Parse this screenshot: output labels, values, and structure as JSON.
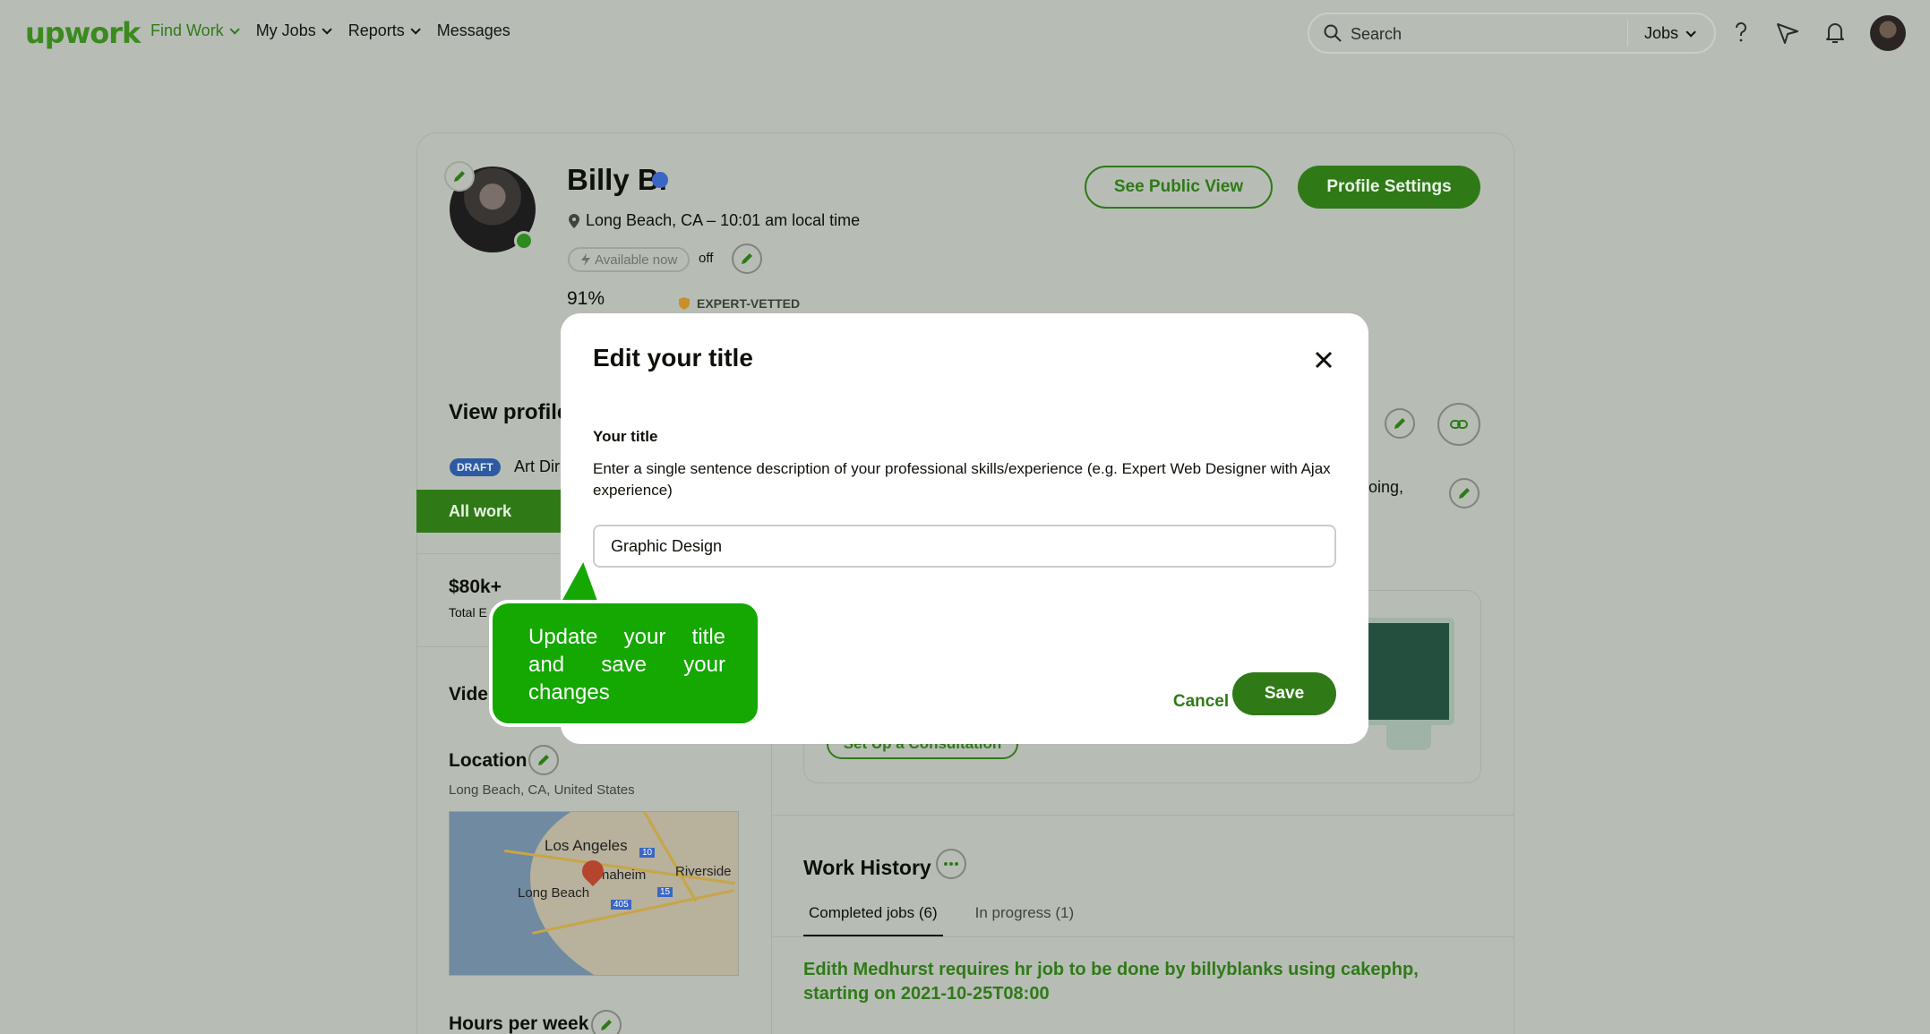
{
  "nav": {
    "logo": "upwork",
    "links": [
      {
        "label": "Find Work"
      },
      {
        "label": "My Jobs"
      },
      {
        "label": "Reports"
      },
      {
        "label": "Messages"
      }
    ],
    "search_placeholder": "Search",
    "search_scope": "Jobs"
  },
  "profile": {
    "name": "Billy B.",
    "location": "Long Beach, CA – 10:01 am local time",
    "availability": "Available now",
    "availability_state": "off",
    "completion": "91%",
    "completion_value": 0.91,
    "badge": "EXPERT-VETTED",
    "see_public_view": "See Public View",
    "profile_settings": "Profile Settings",
    "view_profile": "View profile",
    "draft_tag": "DRAFT",
    "specialty": "Art Dir",
    "all_work": "All work",
    "earnings": "$80k+",
    "earnings_label": "Total E",
    "video_label": "Vide",
    "location_heading": "Location",
    "location_detail": "Long Beach, CA, United States",
    "hours_heading": "Hours per week",
    "overview_fragment": "oing,"
  },
  "map": {
    "labels": [
      "Los Angeles",
      "naheim",
      "Riverside",
      "Long Beach",
      "10",
      "405",
      "15"
    ]
  },
  "consultation": {
    "button": "Set Up a Consultation"
  },
  "work_history": {
    "title": "Work History",
    "tabs": [
      "Completed jobs (6)",
      "In progress (1)"
    ],
    "first_job": "Edith Medhurst requires hr job to be done by billyblanks using cakephp, starting on 2021-10-25T08:00"
  },
  "modal": {
    "title": "Edit your title",
    "field_label": "Your title",
    "description": "Enter a single sentence description of your professional skills/experience (e.g. Expert Web Designer with Ajax experience)",
    "input_value": "Graphic Design",
    "cancel": "Cancel",
    "save": "Save"
  },
  "tooltip": {
    "text": "Update your title and save your changes"
  },
  "colors": {
    "brand_green": "#2f7a17",
    "tooltip_green": "#14a800",
    "backdrop": "#b7bdb5"
  }
}
